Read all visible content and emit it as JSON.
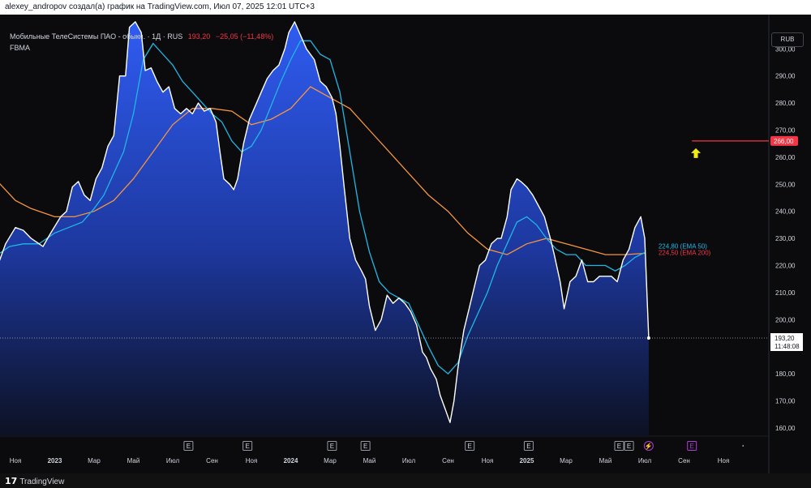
{
  "header": {
    "caption": "alexey_andropov создал(а) график на TradingView.com, Июл 07, 2025 12:01 UTC+3"
  },
  "legend": {
    "symbol": "Мобильные ТелеСистемы ПАО - обыкн. · 1Д · RUS",
    "price": "193,20",
    "change": "−25,05 (−11,48%)",
    "indicator": "FBMA"
  },
  "currency_button": "RUB",
  "footer": {
    "logo_text": "TradingView"
  },
  "colors": {
    "price_line": "#ffffff",
    "area_top": "#2f5cf2",
    "area_bottom": "#0d1226",
    "ema50": "#1fb8e6",
    "ema200": "#f59540",
    "alert": "#f23645",
    "arrow": "#f2ea15",
    "earnings_marker": "#9598a1",
    "dividend_marker": "#b23bd6"
  },
  "chart_data": {
    "type": "area",
    "title": "",
    "y_axis": {
      "ticks": [
        "160,00",
        "170,00",
        "180,00",
        "190,00",
        "200,00",
        "210,00",
        "220,00",
        "230,00",
        "240,00",
        "250,00",
        "260,00",
        "270,00",
        "280,00",
        "290,00",
        "300,00"
      ],
      "range": [
        153,
        310
      ]
    },
    "x_axis": {
      "labels": [
        "Ноя",
        "2023",
        "Мар",
        "Май",
        "Июл",
        "Сен",
        "Ноя",
        "2024",
        "Мар",
        "Май",
        "Июл",
        "Сен",
        "Ноя",
        "2025",
        "Мар",
        "Май",
        "Июл",
        "Сен",
        "Ноя"
      ],
      "label_months": [
        -2,
        0,
        2,
        4,
        6,
        8,
        10,
        12,
        14,
        16,
        18,
        20,
        22,
        24,
        26,
        28,
        30,
        32,
        34
      ],
      "note": "months since Jan 2023"
    },
    "price_series": {
      "name": "",
      "points": [
        [
          -2.9,
          220
        ],
        [
          -2.5,
          228
        ],
        [
          -2.0,
          234
        ],
        [
          -1.6,
          233
        ],
        [
          -1.2,
          230
        ],
        [
          -0.6,
          227
        ],
        [
          -0.2,
          232
        ],
        [
          0.3,
          238
        ],
        [
          0.6,
          240
        ],
        [
          0.9,
          249
        ],
        [
          1.2,
          251
        ],
        [
          1.5,
          246
        ],
        [
          1.8,
          244
        ],
        [
          2.1,
          252
        ],
        [
          2.4,
          256
        ],
        [
          2.7,
          264
        ],
        [
          3.0,
          268
        ],
        [
          3.3,
          290
        ],
        [
          3.6,
          290
        ],
        [
          3.8,
          308
        ],
        [
          4.1,
          310
        ],
        [
          4.4,
          306
        ],
        [
          4.6,
          292
        ],
        [
          4.9,
          293
        ],
        [
          5.2,
          288
        ],
        [
          5.5,
          284
        ],
        [
          5.8,
          286
        ],
        [
          6.1,
          278
        ],
        [
          6.4,
          276
        ],
        [
          6.7,
          278
        ],
        [
          7.0,
          276
        ],
        [
          7.3,
          280
        ],
        [
          7.6,
          277
        ],
        [
          7.9,
          278
        ],
        [
          8.2,
          273
        ],
        [
          8.4,
          262
        ],
        [
          8.6,
          252
        ],
        [
          8.9,
          250
        ],
        [
          9.1,
          248
        ],
        [
          9.3,
          252
        ],
        [
          9.6,
          265
        ],
        [
          9.9,
          274
        ],
        [
          10.2,
          279
        ],
        [
          10.5,
          284
        ],
        [
          10.8,
          289
        ],
        [
          11.1,
          292
        ],
        [
          11.4,
          294
        ],
        [
          11.7,
          300
        ],
        [
          11.9,
          306
        ],
        [
          12.2,
          310
        ],
        [
          12.5,
          305
        ],
        [
          12.8,
          300
        ],
        [
          13.2,
          296
        ],
        [
          13.5,
          288
        ],
        [
          13.8,
          286
        ],
        [
          14.1,
          282
        ],
        [
          14.3,
          276
        ],
        [
          14.5,
          264
        ],
        [
          14.7,
          250
        ],
        [
          15.0,
          230
        ],
        [
          15.3,
          222
        ],
        [
          15.6,
          218
        ],
        [
          15.8,
          215
        ],
        [
          16.0,
          205
        ],
        [
          16.3,
          196
        ],
        [
          16.6,
          200
        ],
        [
          16.9,
          209
        ],
        [
          17.2,
          206
        ],
        [
          17.5,
          208
        ],
        [
          17.8,
          206
        ],
        [
          18.1,
          203
        ],
        [
          18.4,
          198
        ],
        [
          18.7,
          188
        ],
        [
          18.9,
          186
        ],
        [
          19.1,
          182
        ],
        [
          19.4,
          178
        ],
        [
          19.6,
          172
        ],
        [
          19.9,
          166
        ],
        [
          20.1,
          162
        ],
        [
          20.3,
          170
        ],
        [
          20.5,
          182
        ],
        [
          20.8,
          196
        ],
        [
          21.1,
          205
        ],
        [
          21.4,
          214
        ],
        [
          21.6,
          220
        ],
        [
          21.9,
          222
        ],
        [
          22.2,
          228
        ],
        [
          22.5,
          230
        ],
        [
          22.7,
          230
        ],
        [
          23.0,
          238
        ],
        [
          23.2,
          248
        ],
        [
          23.5,
          252
        ],
        [
          23.7,
          251
        ],
        [
          24.0,
          249
        ],
        [
          24.3,
          246
        ],
        [
          24.6,
          242
        ],
        [
          24.9,
          238
        ],
        [
          25.2,
          230
        ],
        [
          25.4,
          224
        ],
        [
          25.7,
          214
        ],
        [
          25.9,
          204
        ],
        [
          26.2,
          214
        ],
        [
          26.5,
          216
        ],
        [
          26.8,
          222
        ],
        [
          27.1,
          214
        ],
        [
          27.4,
          214
        ],
        [
          27.7,
          216
        ],
        [
          28.0,
          216
        ],
        [
          28.3,
          216
        ],
        [
          28.6,
          214
        ],
        [
          28.9,
          222
        ],
        [
          29.2,
          226
        ],
        [
          29.5,
          234
        ],
        [
          29.8,
          238
        ],
        [
          30.0,
          230
        ],
        [
          30.2,
          193.2
        ]
      ]
    },
    "ema50": {
      "name": "EMA 50",
      "label": "224,80 (EMA 50)",
      "last": 224.8,
      "points": [
        [
          -2.9,
          224
        ],
        [
          -2.3,
          227
        ],
        [
          -1.6,
          228
        ],
        [
          -0.8,
          228
        ],
        [
          0.0,
          232
        ],
        [
          0.7,
          234
        ],
        [
          1.4,
          236
        ],
        [
          2.0,
          241
        ],
        [
          2.5,
          246
        ],
        [
          3.0,
          254
        ],
        [
          3.5,
          262
        ],
        [
          4.0,
          276
        ],
        [
          4.5,
          296
        ],
        [
          5.0,
          302
        ],
        [
          5.5,
          298
        ],
        [
          6.0,
          294
        ],
        [
          6.5,
          288
        ],
        [
          7.0,
          284
        ],
        [
          7.5,
          280
        ],
        [
          8.0,
          276
        ],
        [
          8.5,
          273
        ],
        [
          9.0,
          266
        ],
        [
          9.5,
          262
        ],
        [
          10.0,
          264
        ],
        [
          10.5,
          270
        ],
        [
          11.0,
          279
        ],
        [
          11.5,
          288
        ],
        [
          12.0,
          296
        ],
        [
          12.5,
          303
        ],
        [
          13.0,
          303
        ],
        [
          13.5,
          298
        ],
        [
          14.0,
          296
        ],
        [
          14.5,
          284
        ],
        [
          15.0,
          262
        ],
        [
          15.5,
          240
        ],
        [
          16.0,
          225
        ],
        [
          16.5,
          214
        ],
        [
          17.0,
          210
        ],
        [
          17.5,
          208
        ],
        [
          18.0,
          206
        ],
        [
          18.5,
          198
        ],
        [
          19.0,
          190
        ],
        [
          19.5,
          183
        ],
        [
          20.0,
          180
        ],
        [
          20.5,
          184
        ],
        [
          21.0,
          194
        ],
        [
          21.5,
          202
        ],
        [
          22.0,
          210
        ],
        [
          22.5,
          220
        ],
        [
          23.0,
          228
        ],
        [
          23.5,
          236
        ],
        [
          24.0,
          238
        ],
        [
          24.5,
          235
        ],
        [
          25.0,
          230
        ],
        [
          25.5,
          226
        ],
        [
          26.0,
          224
        ],
        [
          26.5,
          224
        ],
        [
          27.0,
          220
        ],
        [
          27.5,
          220
        ],
        [
          28.0,
          220
        ],
        [
          28.5,
          218
        ],
        [
          29.0,
          220
        ],
        [
          29.5,
          223
        ],
        [
          30.0,
          224.8
        ]
      ]
    },
    "ema200": {
      "name": "EMA 200",
      "label": "224,50 (EMA 200)",
      "last": 224.5,
      "points": [
        [
          -2.9,
          251
        ],
        [
          -2.0,
          244
        ],
        [
          -1.2,
          241
        ],
        [
          0.0,
          238
        ],
        [
          1.0,
          238
        ],
        [
          2.0,
          240
        ],
        [
          3.0,
          244
        ],
        [
          4.0,
          252
        ],
        [
          5.0,
          262
        ],
        [
          6.0,
          272
        ],
        [
          7.0,
          278
        ],
        [
          8.0,
          278
        ],
        [
          9.0,
          277
        ],
        [
          10.0,
          272
        ],
        [
          11.0,
          274
        ],
        [
          12.0,
          278
        ],
        [
          13.0,
          286
        ],
        [
          14.0,
          282
        ],
        [
          15.0,
          278
        ],
        [
          16.0,
          270
        ],
        [
          17.0,
          262
        ],
        [
          18.0,
          254
        ],
        [
          19.0,
          246
        ],
        [
          20.0,
          240
        ],
        [
          21.0,
          232
        ],
        [
          22.0,
          226
        ],
        [
          23.0,
          224
        ],
        [
          24.0,
          228
        ],
        [
          25.0,
          230
        ],
        [
          26.0,
          228
        ],
        [
          27.0,
          226
        ],
        [
          28.0,
          224
        ],
        [
          29.0,
          224
        ],
        [
          30.0,
          224.5
        ]
      ]
    },
    "last_price": {
      "value": 193.2,
      "label": "193,20",
      "countdown": "11:48:08"
    },
    "alert_level": {
      "value": 266,
      "label": "266,00",
      "x_start_month": 32.4
    },
    "arrow": {
      "value": 261.5,
      "x_month": 32.6,
      "direction": "up"
    },
    "event_markers": [
      {
        "x_month": 6.8,
        "glyph": "E",
        "kind": "earnings"
      },
      {
        "x_month": 9.8,
        "glyph": "E",
        "kind": "earnings"
      },
      {
        "x_month": 14.1,
        "glyph": "E",
        "kind": "earnings"
      },
      {
        "x_month": 15.8,
        "glyph": "E",
        "kind": "earnings"
      },
      {
        "x_month": 21.1,
        "glyph": "E",
        "kind": "earnings"
      },
      {
        "x_month": 24.1,
        "glyph": "E",
        "kind": "earnings"
      },
      {
        "x_month": 28.7,
        "glyph": "E",
        "kind": "earnings"
      },
      {
        "x_month": 29.2,
        "glyph": "E",
        "kind": "earnings"
      },
      {
        "x_month": 30.2,
        "glyph": "⚡",
        "kind": "dividend"
      },
      {
        "x_month": 32.4,
        "glyph": "E",
        "kind": "upcoming"
      },
      {
        "x_month": 35.0,
        "glyph": "·",
        "kind": "upcoming"
      }
    ],
    "grid": false
  }
}
